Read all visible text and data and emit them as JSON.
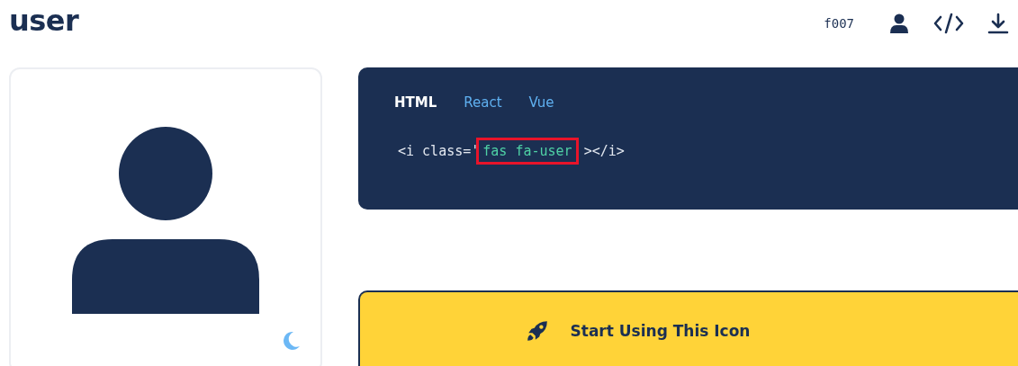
{
  "title": "user",
  "unicode": "f007",
  "tabs": [
    {
      "label": "HTML",
      "selected": true
    },
    {
      "label": "React",
      "selected": false
    },
    {
      "label": "Vue",
      "selected": false
    }
  ],
  "code": {
    "before": "<i class='",
    "highlight": "fas fa-user",
    "after": " ></i>"
  },
  "cta": {
    "label": "Start Using This Icon"
  }
}
